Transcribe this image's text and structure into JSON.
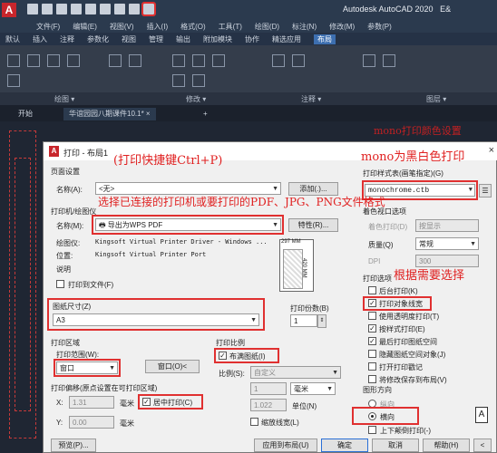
{
  "app": {
    "title": "Autodesk AutoCAD 2020",
    "title_suffix": "E&",
    "logo": "A",
    "menus": [
      "文件(F)",
      "编辑(E)",
      "视图(V)",
      "插入(I)",
      "格式(O)",
      "工具(T)",
      "绘图(D)",
      "标注(N)",
      "修改(M)",
      "参数(P)"
    ],
    "ribbon_tabs": [
      "默认",
      "插入",
      "注释",
      "参数化",
      "视图",
      "管理",
      "输出",
      "附加模块",
      "协作",
      "精选应用",
      "布局"
    ],
    "active_ribbon_tab": "布局",
    "ribbon_panels": [
      "绘图 ▾",
      "修改 ▾",
      "注释 ▾",
      "图层 ▾"
    ],
    "doc_tabs": [
      "开始",
      "华谊园园八期课件10.1*"
    ],
    "doc_tab_close": "×",
    "doc_tab_add": "+"
  },
  "dialog": {
    "title": "打印 - 布局1",
    "close_icon": "×",
    "page_setup": {
      "section": "页面设置",
      "name_label": "名称(A):",
      "name_value": "<无>",
      "add_button": "添加(.)..."
    },
    "printer": {
      "section": "打印机/绘图仪",
      "name_label": "名称(M):",
      "name_value": "导出为WPS PDF",
      "properties_button": "特性(R)...",
      "plotter_label": "绘图仪:",
      "plotter_value": "Kingsoft Virtual Printer Driver - Windows ...",
      "where_label": "位置:",
      "where_value": "Kingsoft Virtual Printer Port",
      "desc_label": "说明",
      "print_to_file": "打印到文件(F)",
      "paper_width": "297 MM",
      "paper_height": "420 MM"
    },
    "paper_size": {
      "section": "图纸尺寸(Z)",
      "value": "A3"
    },
    "copies": {
      "label": "打印份数(B)",
      "value": "1"
    },
    "plot_area": {
      "section": "打印区域",
      "what_label": "打印范围(W):",
      "what_value": "窗口",
      "window_button": "窗口(O)<"
    },
    "plot_offset": {
      "section": "打印偏移(原点设置在可打印区域)",
      "x_label": "X:",
      "x_value": "1.31",
      "x_unit": "毫米",
      "y_label": "Y:",
      "y_value": "0.00",
      "y_unit": "毫米",
      "center": "居中打印(C)"
    },
    "plot_scale": {
      "section": "打印比例",
      "fit": "布满图纸(I)",
      "scale_label": "比例(S):",
      "scale_value": "自定义",
      "units_value1": "1",
      "units_unit": "毫米",
      "units_value2": "1.022",
      "units_unit2": "单位(N)",
      "scale_lineweights": "缩放线宽(L)"
    },
    "plot_style": {
      "section": "打印样式表(画笔指定)(G)",
      "value": "monochrome.ctb",
      "edit_icon": "list-icon"
    },
    "shaded": {
      "section": "着色视口选项",
      "shade_label": "着色打印(D)",
      "shade_value": "按显示",
      "quality_label": "质量(Q)",
      "quality_value": "常规",
      "dpi_label": "DPI",
      "dpi_value": "300"
    },
    "options": {
      "section": "打印选项",
      "items": [
        {
          "label": "后台打印(K)",
          "checked": false
        },
        {
          "label": "打印对象线宽",
          "checked": true
        },
        {
          "label": "使用透明度打印(T)",
          "checked": false
        },
        {
          "label": "按样式打印(E)",
          "checked": true
        },
        {
          "label": "最后打印图纸空间",
          "checked": true
        },
        {
          "label": "隐藏图纸空间对象(J)",
          "checked": false
        },
        {
          "label": "打开打印戳记",
          "checked": false
        },
        {
          "label": "将修改保存到布局(V)",
          "checked": false
        }
      ]
    },
    "orientation": {
      "section": "图形方向",
      "portrait": "纵向",
      "landscape": "横向",
      "upside_down": "上下颠倒打印(-)",
      "selected": "横向",
      "icon": "A"
    },
    "bottom": {
      "preview": "预览(P)...",
      "apply": "应用到布局(U)",
      "ok": "确定",
      "cancel": "取消",
      "help": "帮助(H)",
      "expand": "<"
    }
  },
  "annotations": {
    "shortcut": "(打印快捷键Ctrl+P)",
    "mono": "mono为黑白色打印",
    "printer_choice": "选择已连接的打印机或要打印的PDF、JPG、PNG文件格式",
    "as_needed": "根据需要选择",
    "top_cut": "mono打印颜色设置"
  },
  "colors": {
    "annotation_red": "#e02020",
    "title_bar": "#2b3a4e",
    "active_tab": "#3d6fb0"
  }
}
